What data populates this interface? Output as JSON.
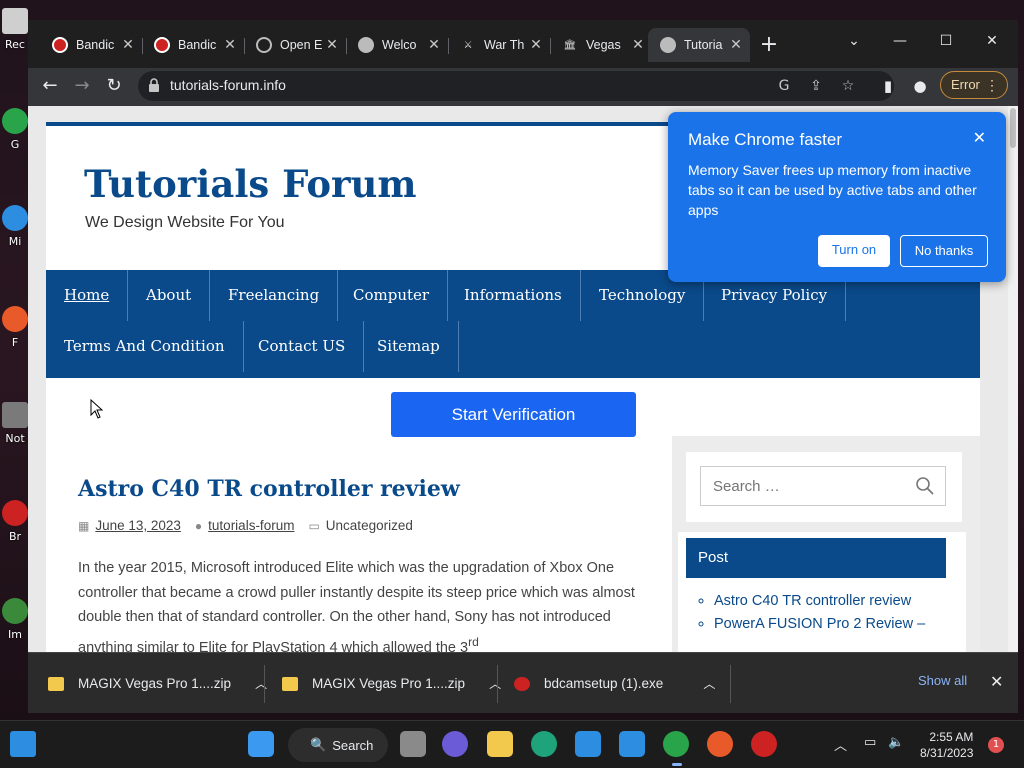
{
  "desktop": {
    "icons": [
      {
        "label": "Rec",
        "color": "#cfcfcf"
      },
      {
        "label": "G",
        "color": "#2aa44b"
      },
      {
        "label": "Mi",
        "color": "#2d8de0"
      },
      {
        "label": "F",
        "color": "#e85a2a"
      },
      {
        "label": "Not",
        "color": "#7a7a7a"
      },
      {
        "label": "Br",
        "color": "#cc2222"
      },
      {
        "label": "Im",
        "color": "#3b8a3b"
      }
    ]
  },
  "browser": {
    "tabs": [
      {
        "label": "Bandic",
        "icon": "record-icon"
      },
      {
        "label": "Bandic",
        "icon": "record-icon"
      },
      {
        "label": "Open E",
        "icon": "globe-icon"
      },
      {
        "label": "Welco",
        "icon": "globe-icon"
      },
      {
        "label": "War Th",
        "icon": "sword-icon"
      },
      {
        "label": "Vegas",
        "icon": "bank-icon"
      },
      {
        "label": "Tutoria",
        "icon": "globe-icon"
      }
    ],
    "url": "tutorials-forum.info",
    "profile_button": "Error"
  },
  "site": {
    "title": "Tutorials Forum",
    "tagline": "We Design Website For You",
    "nav": [
      "Home",
      "About",
      "Freelancing",
      "Computer",
      "Informations",
      "Technology",
      "Privacy Policy",
      "Terms And Condition",
      "Contact US",
      "Sitemap"
    ],
    "verify_button": "Start Verification",
    "post": {
      "title": "Astro C40 TR controller review",
      "date": "June 13, 2023",
      "author": "tutorials-forum",
      "category": "Uncategorized",
      "excerpt": "In the year 2015, Microsoft introduced Elite which was the upgradation of Xbox One controller that became a crowd puller instantly despite its steep price which was almost double then that of standard controller. On the other hand, Sony has not introduced anything similar to Elite for PlayStation 4 which allowed the 3",
      "excerpt_sup": "rd"
    },
    "sidebar": {
      "search_placeholder": "Search …",
      "post_heading": "Post",
      "post_links": [
        "Astro C40 TR controller review",
        "PowerA FUSION Pro 2 Review –"
      ]
    }
  },
  "popup": {
    "title": "Make Chrome faster",
    "body": "Memory Saver frees up memory from inactive tabs so it can be used by active tabs and other apps",
    "turn_on": "Turn on",
    "no_thanks": "No thanks"
  },
  "downloads": {
    "items": [
      {
        "name": "MAGIX Vegas Pro 1....zip",
        "icon": "zip-icon",
        "color": "#f2c94c"
      },
      {
        "name": "MAGIX Vegas Pro 1....zip",
        "icon": "zip-icon",
        "color": "#f2c94c"
      },
      {
        "name": "bdcamsetup (1).exe",
        "icon": "exe-icon",
        "color": "#cc2222"
      }
    ],
    "show_all": "Show all"
  },
  "taskbar": {
    "search_label": "Search",
    "time": "2:55 AM",
    "date": "8/31/2023",
    "notifications": "1"
  }
}
